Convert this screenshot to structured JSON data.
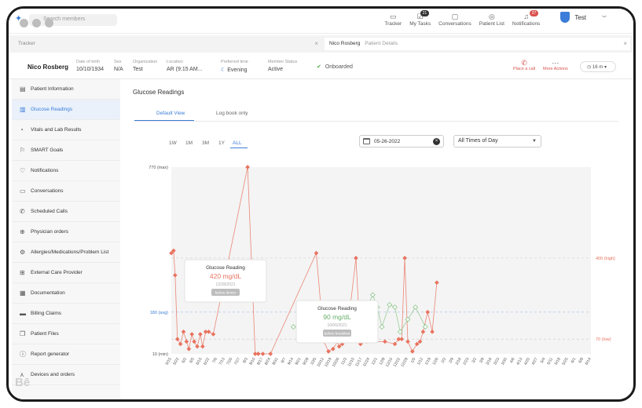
{
  "search": {
    "placeholder": "Search members"
  },
  "nav": [
    {
      "label": "Tracker",
      "badge": ""
    },
    {
      "label": "My Tasks",
      "badge": "21"
    },
    {
      "label": "Conversations",
      "badge": ""
    },
    {
      "label": "Patient List",
      "badge": ""
    },
    {
      "label": "Notifications",
      "badge": "27"
    }
  ],
  "user": {
    "name": "Test"
  },
  "tabs": [
    {
      "label": "Tracker"
    },
    {
      "label": "Nico Rosberg",
      "sub": "Patient Details"
    }
  ],
  "patient": {
    "name": "Nico Rosberg",
    "fields": [
      {
        "label": "Date of birth",
        "value": "10/10/1934"
      },
      {
        "label": "Sex",
        "value": "N/A"
      },
      {
        "label": "Organization",
        "value": "Test"
      },
      {
        "label": "Location",
        "value": "AR (9:15 AM..."
      },
      {
        "label": "Preferred time",
        "value": "Evening"
      },
      {
        "label": "Member Status",
        "value": "Active"
      }
    ],
    "status": "Onboarded",
    "actions": [
      "Place a call",
      "More Actions"
    ],
    "timer": "16 m"
  },
  "sidebar": [
    {
      "label": "Patient Information",
      "icon": "id-card-icon"
    },
    {
      "label": "Glucose Readings",
      "icon": "glucose-icon",
      "active": true
    },
    {
      "label": "Vitals and Lab Results",
      "icon": "vitals-icon"
    },
    {
      "label": "SMART Goals",
      "icon": "flag-icon"
    },
    {
      "label": "Notifications",
      "icon": "bell-icon"
    },
    {
      "label": "Conversations",
      "icon": "chat-icon"
    },
    {
      "label": "Scheduled Calls",
      "icon": "phone-icon"
    },
    {
      "label": "Physician orders",
      "icon": "orders-icon"
    },
    {
      "label": "Allergies/Medications/Problem List",
      "icon": "gear-icon"
    },
    {
      "label": "External Care Provider",
      "icon": "provider-icon"
    },
    {
      "label": "Documentation",
      "icon": "document-icon"
    },
    {
      "label": "Billing Claims",
      "icon": "card-icon"
    },
    {
      "label": "Patient Files",
      "icon": "files-icon"
    },
    {
      "label": "Report generator",
      "icon": "report-icon"
    },
    {
      "label": "Devices and orders",
      "icon": "devices-icon"
    }
  ],
  "main": {
    "title": "Glucose Readings",
    "view_tabs": [
      "Default View",
      "Log book only"
    ],
    "ranges": [
      "1W",
      "1M",
      "3M",
      "1Y",
      "ALL"
    ],
    "date": "05-26-2022",
    "time_of_day": "All Times of Day"
  },
  "chart_data": {
    "type": "line",
    "y_ticks": [
      {
        "value": 10,
        "label": "10 (min)"
      },
      {
        "value": 180,
        "label": "180 (avg)"
      },
      {
        "value": 770,
        "label": "770 (max)"
      }
    ],
    "y_axis_right": [
      {
        "value": 400,
        "label": "400 (high)"
      },
      {
        "value": 70,
        "label": "70 (low)"
      }
    ],
    "ylim": [
      10,
      770
    ],
    "categories": [
      "5/15",
      "5/22",
      "6/2",
      "6/5",
      "6/15",
      "6/22",
      "7/6",
      "7/13",
      "7/20",
      "7/27",
      "8/3",
      "8/10",
      "8/17",
      "8/24",
      "8/31",
      "9/7",
      "9/14",
      "9/21",
      "9/28",
      "10/5",
      "10/12",
      "10/19",
      "10/26",
      "11/3",
      "11/10",
      "11/17",
      "11/24",
      "12/1",
      "12/8",
      "12/15",
      "12/22",
      "12/29",
      "1/5",
      "1/12",
      "1/19",
      "1/26",
      "2/2",
      "2/9",
      "2/16",
      "2/23",
      "3/2",
      "3/9",
      "3/16",
      "3/23",
      "3/30",
      "4/6",
      "4/13",
      "4/20",
      "4/27",
      "5/4",
      "5/11",
      "5/18",
      "5/25",
      "6/1",
      "6/8",
      "6/14"
    ],
    "series": [
      {
        "color": "#e8735f",
        "points": [
          [
            0,
            420
          ],
          [
            0.3,
            430
          ],
          [
            0.5,
            330
          ],
          [
            0.8,
            70
          ],
          [
            1.2,
            50
          ],
          [
            1.6,
            100
          ],
          [
            2,
            60
          ],
          [
            2.3,
            30
          ],
          [
            2.7,
            90
          ],
          [
            3,
            60
          ],
          [
            3.4,
            40
          ],
          [
            3.8,
            90
          ],
          [
            4.1,
            40
          ],
          [
            4.5,
            100
          ],
          [
            4.9,
            100
          ],
          [
            5.5,
            90
          ],
          [
            10,
            770
          ],
          [
            11,
            10
          ],
          [
            11.4,
            10
          ],
          [
            12,
            10
          ],
          [
            13,
            10
          ],
          [
            19,
            420
          ],
          [
            20,
            60
          ],
          [
            20.6,
            20
          ],
          [
            21.2,
            30
          ],
          [
            21.8,
            60
          ],
          [
            22,
            40
          ],
          [
            22.4,
            50
          ],
          [
            23,
            80
          ],
          [
            24.2,
            400
          ],
          [
            24.8,
            50
          ],
          [
            25.6,
            60
          ],
          [
            28,
            60
          ],
          [
            29.3,
            50
          ],
          [
            29.8,
            70
          ],
          [
            30.2,
            70
          ],
          [
            30.6,
            400
          ],
          [
            31,
            60
          ],
          [
            31.6,
            20
          ],
          [
            32.2,
            50
          ],
          [
            32.6,
            60
          ],
          [
            33,
            100
          ],
          [
            33.6,
            180
          ],
          [
            34.2,
            100
          ],
          [
            34.8,
            300
          ]
        ]
      },
      {
        "color": "#8bc48a",
        "points": [
          [
            16,
            120
          ],
          [
            23,
            160
          ],
          [
            24,
            180
          ],
          [
            25.2,
            170
          ],
          [
            26.4,
            250
          ],
          [
            27,
            200
          ],
          [
            27.6,
            120
          ],
          [
            28.6,
            210
          ],
          [
            29.3,
            200
          ],
          [
            30,
            100
          ],
          [
            31,
            150
          ],
          [
            32,
            200
          ],
          [
            33.3,
            120
          ]
        ]
      }
    ],
    "tooltips": [
      {
        "title": "Glucose Reading",
        "value": "420 mg/dL",
        "date": "12/28/2021",
        "tag": "before dinner",
        "color": "#e8735f"
      },
      {
        "title": "Glucose Reading",
        "value": "90 mg/dL",
        "date": "10/06/2021",
        "tag": "before breakfast",
        "color": "#6ab06b"
      }
    ]
  },
  "colors": {
    "accent": "#3b7dd8",
    "high": "#e8735f",
    "normal": "#8bc48a"
  }
}
